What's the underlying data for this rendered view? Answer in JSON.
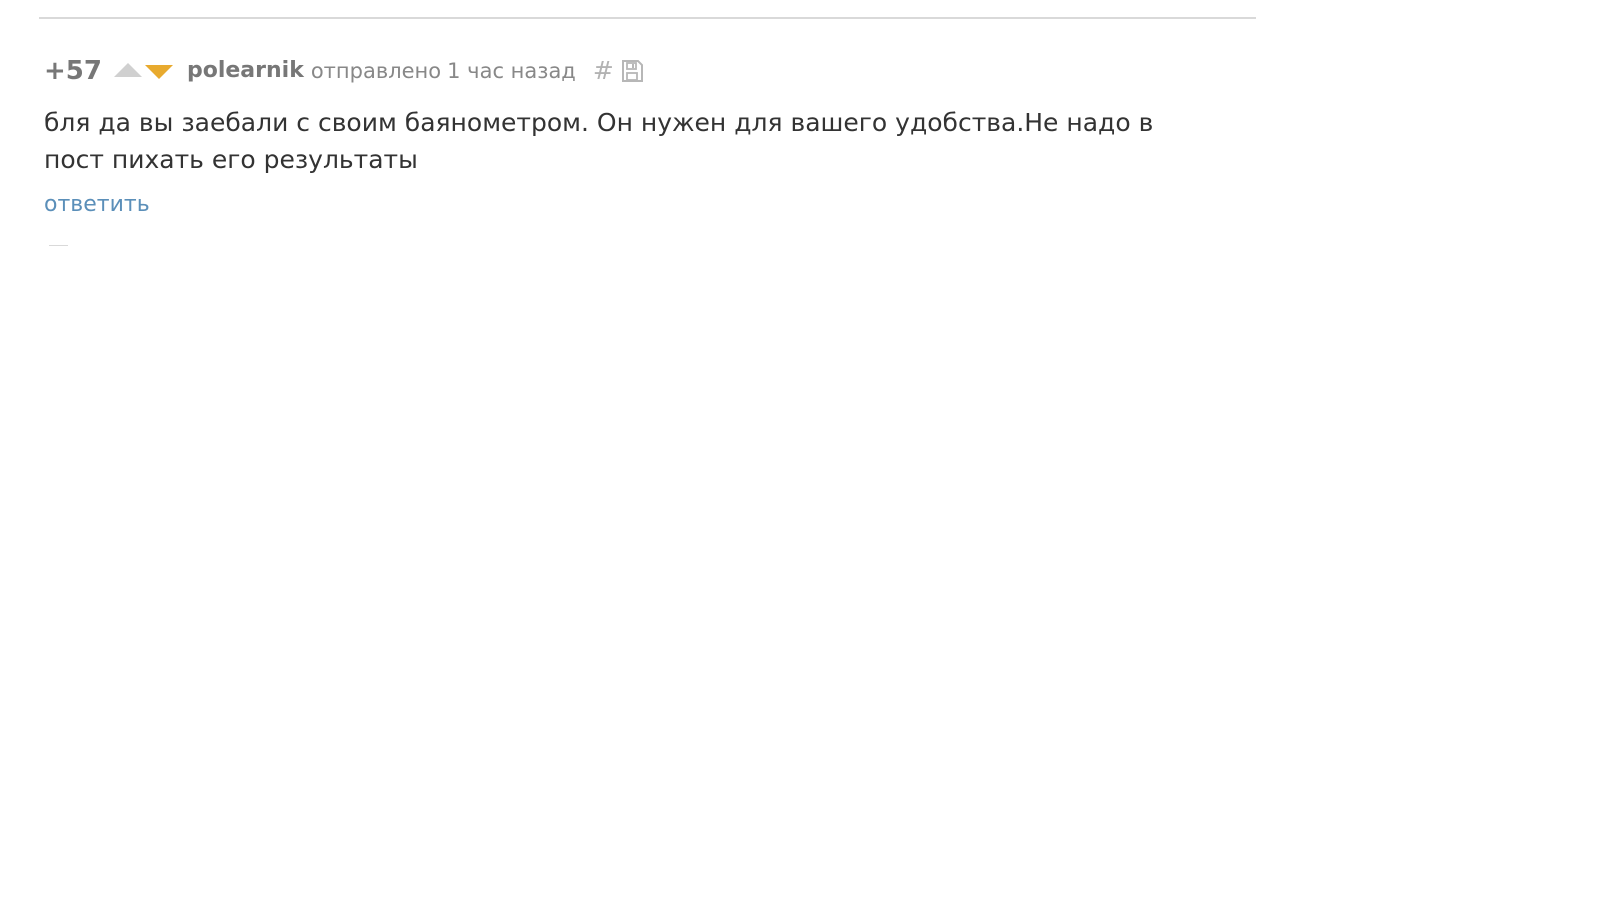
{
  "comment": {
    "rating": "+57",
    "author": "polearnik",
    "sent_label": "отправлено",
    "time_ago": "1 час назад",
    "permalink_symbol": "#",
    "text": "бля да вы заебали с своим баянометром. Он нужен для вашего удобства.Не надо в пост пихать его результаты",
    "reply_label": "ответить",
    "icons": {
      "upvote": "upvote-icon",
      "downvote": "downvote-icon",
      "save": "save-icon"
    },
    "colors": {
      "downvote_active": "#e8aa2e",
      "reply_link": "#5b8fb9",
      "muted_text": "#777777"
    }
  }
}
